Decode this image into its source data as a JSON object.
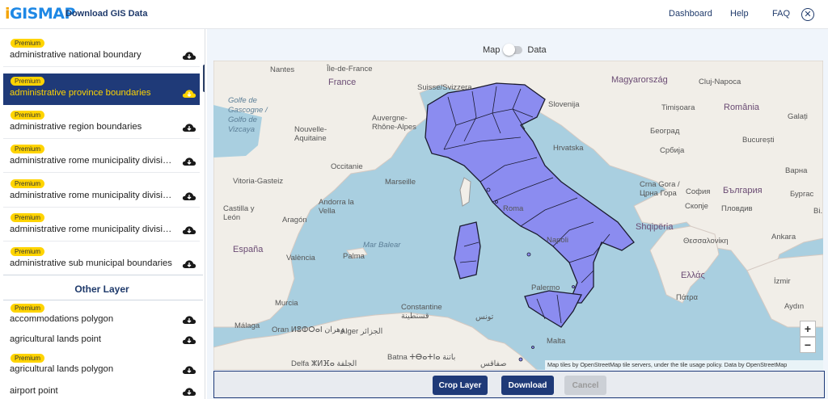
{
  "header": {
    "logo": "iGISMAP",
    "logo_i": "i",
    "logo_rest": "GISMAP",
    "title": "Download GIS Data",
    "nav": [
      "Dashboard",
      "Help",
      "FAQ"
    ]
  },
  "sidebar": {
    "premium_label": "Premium",
    "layers": [
      {
        "name": "administrative national boundary",
        "premium": true,
        "selected": false
      },
      {
        "name": "administrative province boundaries",
        "premium": true,
        "selected": true
      },
      {
        "name": "administrative region boundaries",
        "premium": true,
        "selected": false
      },
      {
        "name": "administrative rome municipality divisio…",
        "premium": true,
        "selected": false
      },
      {
        "name": "administrative rome municipality divisio…",
        "premium": true,
        "selected": false
      },
      {
        "name": "administrative rome municipality divisio…",
        "premium": true,
        "selected": false
      },
      {
        "name": "administrative sub municipal boundaries",
        "premium": true,
        "selected": false
      }
    ],
    "other_title": "Other Layer",
    "other_layers": [
      {
        "name": "accommodations polygon",
        "premium": true
      },
      {
        "name": "agricultural lands point",
        "premium": false
      },
      {
        "name": "agricultural lands polygon",
        "premium": true
      },
      {
        "name": "airport point",
        "premium": false
      }
    ]
  },
  "view_toggle": {
    "left": "Map",
    "right": "Data",
    "state": "Map"
  },
  "map": {
    "labels": [
      "Nantes",
      "Île-de-France",
      "France",
      "Golfe de Gascogne / Golfo de Vizcaya",
      "Nouvelle-Aquitaine",
      "Auvergne-Rhône-Alpes",
      "Suisse/Svizzera",
      "Occitanie",
      "Marseille",
      "Vitoria-Gasteiz",
      "Castilla y León",
      "Aragón",
      "Andorra la Vella",
      "España",
      "València",
      "Palma",
      "Mar Balear",
      "Murcia",
      "Málaga",
      "Oran ⵍⵓⵀⵔⴰⵏ وهران",
      "Alger الجزائر",
      "Constantine قسنطينة",
      "تونس",
      "Batna ⵜⴱⴰⵜⵏⴰ باتنة",
      "Delfa ⵣⵍⴼⴰ الجلفة",
      "صفاقس",
      "Malta",
      "Roma",
      "Napoli",
      "Palermo",
      "Hrvatska",
      "Magyarország",
      "România",
      "Cluj-Napoca",
      "Timișoara",
      "București",
      "Galați",
      "Београд",
      "Србија",
      "Crna Gora / Црна Гора",
      "Shqipëria",
      "София",
      "България",
      "Скопје",
      "Пловдив",
      "Варна",
      "Бургас",
      "Θεσσαλονίκη",
      "Ελλάς",
      "Πάτρα",
      "İzmir",
      "Aydın",
      "Ankara",
      "Slovenija",
      "Bi..."
    ],
    "zoom_in": "+",
    "zoom_out": "−",
    "attribution": "Map tiles by OpenStreetMap tile servers, under the tile usage policy. Data by OpenStreetMap",
    "colors": {
      "sea": "#a9cfe0",
      "land": "#f1eee8",
      "highlight": "#8b8cf0",
      "outline": "#1a1a2e"
    }
  },
  "actions": {
    "crop": "Crop Layer",
    "download": "Download",
    "cancel": "Cancel"
  }
}
